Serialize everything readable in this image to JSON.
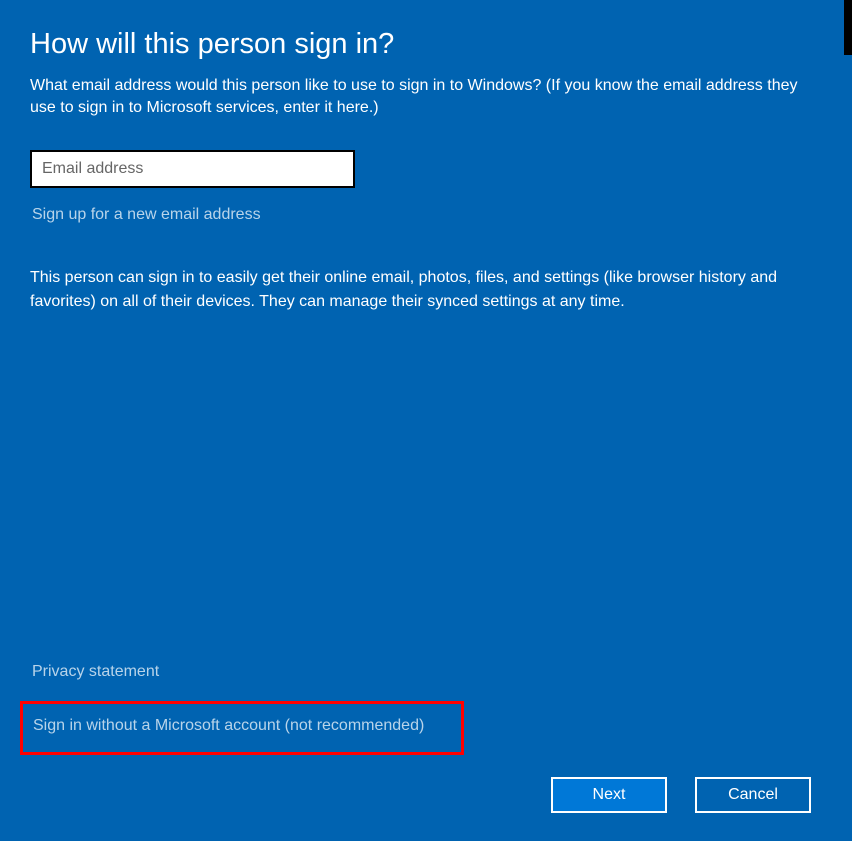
{
  "dialog": {
    "title": "How will this person sign in?",
    "subtitle": "What email address would this person like to use to sign in to Windows? (If you know the email address they use to sign in to Microsoft services, enter it here.)",
    "email_placeholder": "Email address",
    "email_value": "",
    "signup_link": "Sign up for a new email address",
    "info_text": "This person can sign in to easily get their online email, photos, files, and settings (like browser history and favorites) on all of their devices. They can manage their synced settings at any time.",
    "privacy_link": "Privacy statement",
    "no_account_link": "Sign in without a Microsoft account (not recommended)",
    "next_button": "Next",
    "cancel_button": "Cancel"
  },
  "colors": {
    "background": "#0063B1",
    "primary_button": "#0078D7",
    "highlight_border": "#FF0000",
    "link": "#b8d4ea"
  }
}
